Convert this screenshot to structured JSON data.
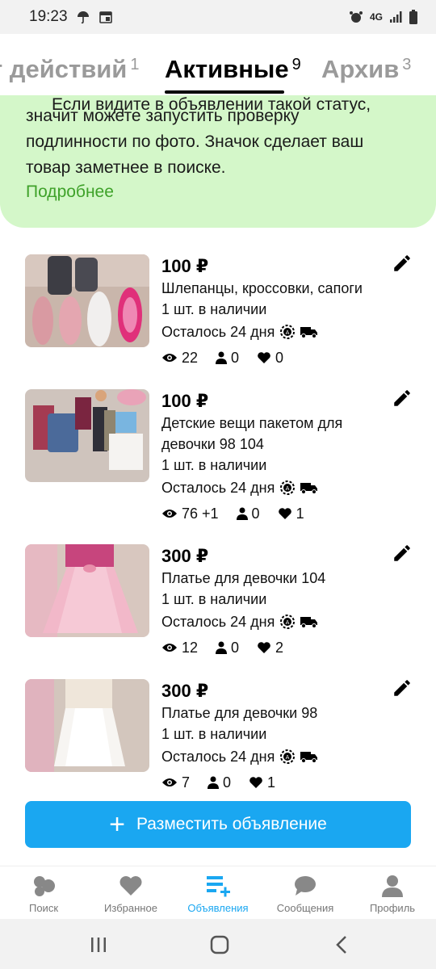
{
  "status_bar": {
    "time": "19:23",
    "network": "4G"
  },
  "tabs": [
    {
      "label": "т действий",
      "count": "1"
    },
    {
      "label": "Активные",
      "count": "9"
    },
    {
      "label": "Архив",
      "count": "3"
    }
  ],
  "banner": {
    "partial_line": "Если видите в объявлении такой статус,",
    "lines": [
      "значит можете запустить проверку",
      "подлинности по фото. Значок сделает ваш",
      "товар заметнее в поиске."
    ],
    "more_label": "Подробнее"
  },
  "listings": [
    {
      "price": "100 ₽",
      "title_lines": [
        "Шлепанцы, кроссовки, сапоги"
      ],
      "stock": "1 шт. в наличии",
      "days": "Осталось 24 дня",
      "views": "22",
      "contacts": "0",
      "likes": "0"
    },
    {
      "price": "100 ₽",
      "title_lines": [
        "Детские вещи пакетом для",
        "девочки 98 104"
      ],
      "stock": "1 шт. в наличии",
      "days": "Осталось 24 дня",
      "views": "76 +1",
      "contacts": "0",
      "likes": "1"
    },
    {
      "price": "300 ₽",
      "title_lines": [
        "Платье для девочки 104"
      ],
      "stock": "1 шт. в наличии",
      "days": "Осталось 24 дня",
      "views": "12",
      "contacts": "0",
      "likes": "2"
    },
    {
      "price": "300 ₽",
      "title_lines": [
        "Платье для девочки 98"
      ],
      "stock": "1 шт. в наличии",
      "days": "Осталось 24 дня",
      "views": "7",
      "contacts": "0",
      "likes": "1"
    }
  ],
  "cta": {
    "label": "Разместить объявление"
  },
  "bottom_nav": [
    {
      "label": "Поиск",
      "icon": "search-circles-icon"
    },
    {
      "label": "Избранное",
      "icon": "heart-icon"
    },
    {
      "label": "Объявления",
      "icon": "listings-icon",
      "active": true
    },
    {
      "label": "Сообщения",
      "icon": "chat-bubble-icon"
    },
    {
      "label": "Профиль",
      "icon": "person-icon"
    }
  ],
  "colors": {
    "accent": "#1aa7f1",
    "banner_bg": "#d4f7c9",
    "link_green": "#3fa22a"
  }
}
